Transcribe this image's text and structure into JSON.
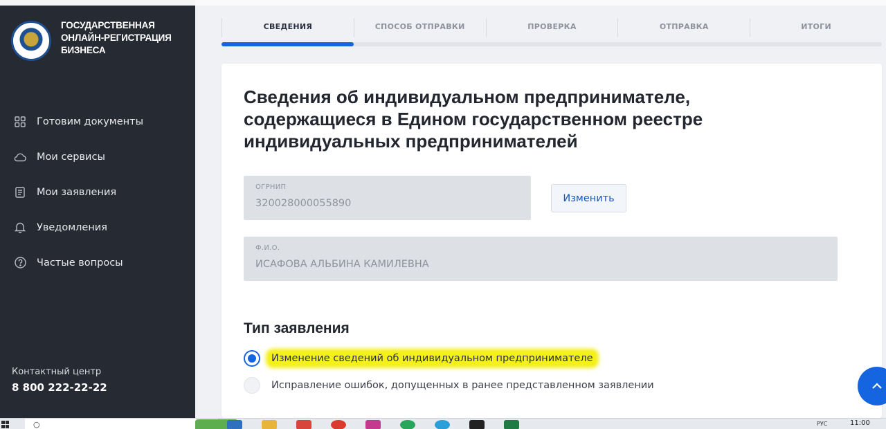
{
  "sidebar": {
    "brand_title": "ГОСУДАРСТВЕННАЯ ОНЛАЙН-РЕГИСТРАЦИЯ БИЗНЕСА",
    "nav": [
      {
        "label": "Готовим документы",
        "icon": "grid-icon"
      },
      {
        "label": "Мои сервисы",
        "icon": "cloud-icon"
      },
      {
        "label": "Мои заявления",
        "icon": "document-icon"
      },
      {
        "label": "Уведомления",
        "icon": "bell-icon"
      },
      {
        "label": "Частые вопросы",
        "icon": "help-icon"
      }
    ],
    "contact_label": "Контактный центр",
    "contact_phone": "8 800 222-22-22"
  },
  "steps": [
    {
      "label": "СВЕДЕНИЯ",
      "active": true
    },
    {
      "label": "СПОСОБ ОТПРАВКИ",
      "active": false
    },
    {
      "label": "ПРОВЕРКА",
      "active": false
    },
    {
      "label": "ОТПРАВКА",
      "active": false
    },
    {
      "label": "ИТОГИ",
      "active": false
    }
  ],
  "progress": {
    "completed_steps": 1,
    "total_steps": 5
  },
  "main": {
    "title": "Сведения об индивидуальном предпринимателе, содержащиеся в Едином государственном реестре индивидуальных предпринимателей",
    "ogrnip": {
      "label": "ОГРНИП",
      "value": "320028000055890"
    },
    "change_button": "Изменить",
    "fio": {
      "label": "Ф.И.О.",
      "value": "ИСАФОВА АЛЬБИНА КАМИЛЕВНА"
    },
    "statement_type_title": "Тип заявления",
    "options": [
      {
        "label": "Изменение сведений об индивидуальном предпринимателе",
        "selected": true
      },
      {
        "label": "Исправление ошибок, допущенных в ранее представленном заявлении",
        "selected": false
      }
    ]
  },
  "taskbar": {
    "clock": "11:00",
    "lang": "РУС"
  },
  "colors": {
    "accent": "#1565e0",
    "sidebar_bg": "#262a33",
    "highlight": "#f4f01a"
  }
}
